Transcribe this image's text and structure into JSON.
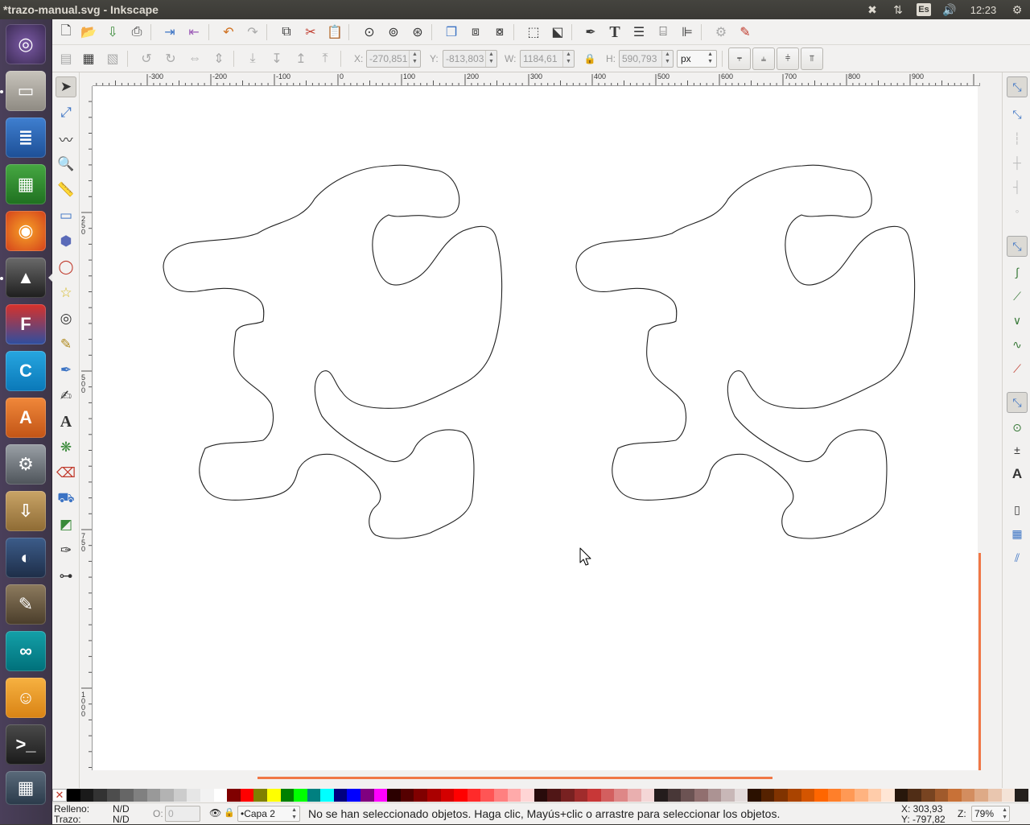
{
  "window": {
    "title": "*trazo-manual.svg - Inkscape"
  },
  "tray": {
    "dropbox": "dropbox-icon",
    "network": "network-icon",
    "lang": "Es",
    "volume": "volume-icon",
    "clock": "12:23",
    "gear": "gear-icon"
  },
  "launcher": [
    "ubuntu-dash",
    "files",
    "writer",
    "calc",
    "firefox",
    "inkscape",
    "freecad",
    "codeblocks",
    "software-center",
    "system-settings",
    "archive-manager",
    "blender",
    "gimp",
    "arduino",
    "scratch",
    "terminal",
    "workspace-switcher"
  ],
  "toolbar": {
    "x_label": "X:",
    "x_value": "-270,851",
    "y_label": "Y:",
    "y_value": "-813,803",
    "w_label": "W:",
    "w_value": "1184,61",
    "h_label": "H:",
    "h_value": "590,793",
    "unit": "px"
  },
  "ruler": {
    "h_labels": [
      "-300",
      "-200",
      "-100",
      "0",
      "100",
      "200",
      "300",
      "400",
      "500",
      "600",
      "700",
      "800",
      "900"
    ],
    "v_labels": [
      "250",
      "500",
      "750",
      "1000"
    ]
  },
  "status": {
    "fill_label": "Relleno:",
    "fill_value": "N/D",
    "stroke_label": "Trazo:",
    "stroke_value": "N/D",
    "opacity_label": "O:",
    "opacity_value": "0",
    "layer": "•Capa 2",
    "message": "No se han seleccionado objetos. Haga clic, Mayús+clic o arrastre para seleccionar los objetos.",
    "x_coord": "X:  303,93",
    "y_coord": "Y: -797,82",
    "zoom_label": "Z:",
    "zoom_value": "79%"
  },
  "palette_colors": [
    "#000000",
    "#1a1a1a",
    "#333333",
    "#4d4d4d",
    "#666666",
    "#808080",
    "#999999",
    "#b3b3b3",
    "#cccccc",
    "#e6e6e6",
    "#f2f2f2",
    "#ffffff",
    "#800000",
    "#ff0000",
    "#808000",
    "#ffff00",
    "#008000",
    "#00ff00",
    "#008080",
    "#00ffff",
    "#000080",
    "#0000ff",
    "#800080",
    "#ff00ff",
    "#2b0000",
    "#550000",
    "#800000",
    "#aa0000",
    "#d40000",
    "#ff0000",
    "#ff2a2a",
    "#ff5555",
    "#ff8080",
    "#ffaaaa",
    "#ffd5d5",
    "#280b0b",
    "#501616",
    "#782121",
    "#a02c2c",
    "#c83737",
    "#d35f5f",
    "#de8787",
    "#e9afaf",
    "#f4d7d7",
    "#241c1c",
    "#483737",
    "#6c5353",
    "#916f6f",
    "#ac9393",
    "#c8b7b7",
    "#e3dbdb",
    "#2b1100",
    "#552200",
    "#803300",
    "#aa4400",
    "#d45500",
    "#ff6600",
    "#ff7f2a",
    "#ff9955",
    "#ffb380",
    "#ffccaa",
    "#ffe6d5",
    "#28170b",
    "#502d16",
    "#784421",
    "#a05a2c",
    "#c87137",
    "#d38d5f",
    "#deaa87",
    "#e9c6af",
    "#f4e3d7",
    "#241f1c"
  ]
}
